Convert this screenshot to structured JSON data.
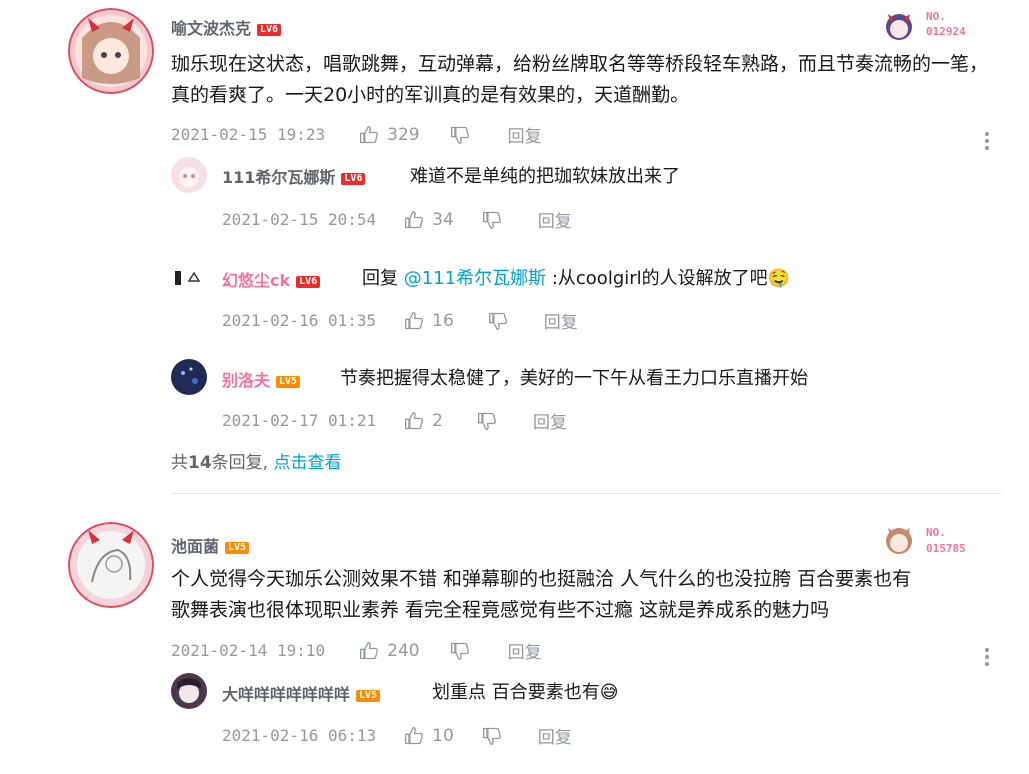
{
  "comments": [
    {
      "user": "喻文波杰克",
      "level": "LV6",
      "badge_no": "NO.",
      "badge_num": "012924",
      "content": "珈乐现在这状态，唱歌跳舞，互动弹幕，给粉丝牌取名等等桥段轻车熟路，而且节奏流畅的一笔，真的看爽了。一天20小时的军训真的是有效果的，天道酬勤。",
      "time": "2021-02-15 19:23",
      "likes": "329",
      "reply_label": "回复",
      "replies": [
        {
          "user": "111希尔瓦娜斯",
          "level": "LV6",
          "text": "难道不是单纯的把珈软妹放出来了",
          "time": "2021-02-15 20:54",
          "likes": "34",
          "reply_label": "回复"
        },
        {
          "user": "幻悠尘ck",
          "level": "LV6",
          "prefix": "回复",
          "mention": "@111希尔瓦娜斯",
          "text": ":从coolgirl的人设解放了吧",
          "emoji": "🤤",
          "time": "2021-02-16 01:35",
          "likes": "16",
          "reply_label": "回复"
        },
        {
          "user": "别洛夫",
          "level": "LV5",
          "text": "节奏把握得太稳健了，美好的一下午从看王力口乐直播开始",
          "time": "2021-02-17 01:21",
          "likes": "2",
          "reply_label": "回复"
        }
      ],
      "more_replies": {
        "prefix": "共",
        "count": "14",
        "suffix": "条回复,",
        "link": "点击查看"
      }
    },
    {
      "user": "池面菌",
      "level": "LV5",
      "badge_no": "NO.",
      "badge_num": "015785",
      "content_line1": "个人觉得今天珈乐公测效果不错 和弹幕聊的也挺融洽 人气什么的也没拉胯 百合要素也有",
      "content_line2": "歌舞表演也很体现职业素养 看完全程竟感觉有些不过瘾 这就是养成系的魅力吗",
      "time": "2021-02-14 19:10",
      "likes": "240",
      "reply_label": "回复",
      "replies": [
        {
          "user": "大咩咩咩咩咩咩咩",
          "level": "LV5",
          "text": "划重点 百合要素也有",
          "emoji": "😅",
          "time": "2021-02-16 06:13",
          "likes": "10",
          "reply_label": "回复"
        }
      ]
    }
  ],
  "colors": {
    "pink": "#fb7299",
    "link": "#00a1d6",
    "meta": "#9499a0",
    "lv6": "#ee2a2a",
    "lv5": "#ff8c00"
  },
  "icons": [
    "like-icon",
    "dislike-icon",
    "more-icon"
  ]
}
